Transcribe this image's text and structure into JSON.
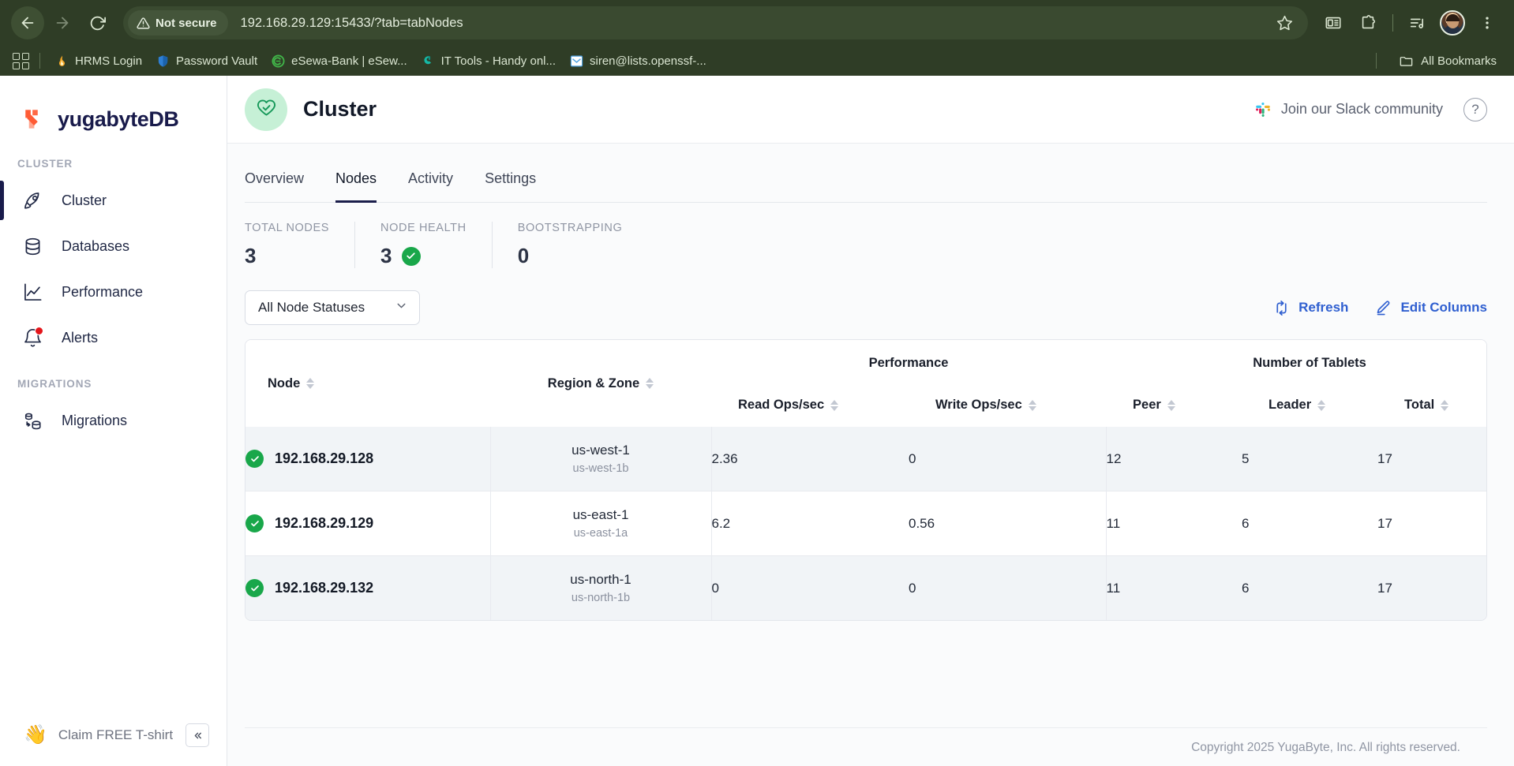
{
  "browser": {
    "security_label": "Not secure",
    "url": "192.168.29.129:15433/?tab=tabNodes",
    "back_icon": "back-arrow-icon",
    "forward_icon": "forward-arrow-icon",
    "reload_icon": "reload-icon",
    "star_icon": "bookmark-star-icon",
    "reading_list_icon": "reading-list-icon",
    "extensions_icon": "extensions-puzzle-icon",
    "media_icon": "media-playlist-icon",
    "menu_icon": "kebab-menu-icon",
    "bookmarks": [
      {
        "label": "HRMS Login",
        "favicon": "flame-icon",
        "color": "#f5a623"
      },
      {
        "label": "Password Vault",
        "favicon": "shield-icon",
        "color": "#2e7fd4"
      },
      {
        "label": "eSewa-Bank | eSew...",
        "favicon": "esewa-icon",
        "color": "#41b549"
      },
      {
        "label": "IT Tools - Handy onl...",
        "favicon": "ittools-icon",
        "color": "#15b8a6"
      },
      {
        "label": "siren@lists.openssf-...",
        "favicon": "mail-icon",
        "color": "#4fa3e3"
      }
    ],
    "all_bookmarks_label": "All Bookmarks",
    "all_bookmarks_icon": "folder-icon",
    "apps_icon": "apps-grid-icon"
  },
  "sidebar": {
    "brand": "yugabyteDB",
    "brand_logo_icon": "yugabyte-logo-icon",
    "sections": [
      {
        "label": "CLUSTER",
        "items": [
          {
            "label": "Cluster",
            "icon": "rocket-icon",
            "selected": true
          },
          {
            "label": "Databases",
            "icon": "database-icon",
            "selected": false
          },
          {
            "label": "Performance",
            "icon": "line-chart-icon",
            "selected": false
          },
          {
            "label": "Alerts",
            "icon": "bell-icon",
            "selected": false,
            "badge": true
          }
        ]
      },
      {
        "label": "MIGRATIONS",
        "items": [
          {
            "label": "Migrations",
            "icon": "migration-icon",
            "selected": false
          }
        ]
      }
    ],
    "tshirt_label": "Claim FREE T-shirt",
    "tshirt_icon": "waving-hand-icon",
    "collapse_icon": "double-chevron-left-icon"
  },
  "header": {
    "title": "Cluster",
    "status_icon": "heart-check-icon",
    "slack_label": "Join our Slack community",
    "slack_icon": "slack-icon",
    "help_label": "?",
    "help_icon": "help-circle-icon"
  },
  "tabs": [
    {
      "label": "Overview",
      "active": false
    },
    {
      "label": "Nodes",
      "active": true
    },
    {
      "label": "Activity",
      "active": false
    },
    {
      "label": "Settings",
      "active": false
    }
  ],
  "stats": [
    {
      "label": "TOTAL NODES",
      "value": "3",
      "check": false
    },
    {
      "label": "NODE HEALTH",
      "value": "3",
      "check": true
    },
    {
      "label": "BOOTSTRAPPING",
      "value": "0",
      "check": false
    }
  ],
  "toolbar": {
    "status_filter_value": "All Node Statuses",
    "status_filter_caret_icon": "chevron-down-icon",
    "refresh_label": "Refresh",
    "refresh_icon": "refresh-icon",
    "edit_columns_label": "Edit Columns",
    "edit_columns_icon": "pencil-icon"
  },
  "table": {
    "group_headers": {
      "performance": "Performance",
      "tablets": "Number of Tablets"
    },
    "columns": {
      "node": "Node",
      "region_zone": "Region & Zone",
      "read_ops": "Read Ops/sec",
      "write_ops": "Write Ops/sec",
      "peer": "Peer",
      "leader": "Leader",
      "total": "Total"
    },
    "sort_icon": "sort-arrows-icon",
    "status_icon": "check-circle-icon",
    "rows": [
      {
        "node": "192.168.29.128",
        "status": "healthy",
        "region": "us-west-1",
        "zone": "us-west-1b",
        "read_ops": "2.36",
        "write_ops": "0",
        "peer": "12",
        "leader": "5",
        "total": "17"
      },
      {
        "node": "192.168.29.129",
        "status": "healthy",
        "region": "us-east-1",
        "zone": "us-east-1a",
        "read_ops": "6.2",
        "write_ops": "0.56",
        "peer": "11",
        "leader": "6",
        "total": "17"
      },
      {
        "node": "192.168.29.132",
        "status": "healthy",
        "region": "us-north-1",
        "zone": "us-north-1b",
        "read_ops": "0",
        "write_ops": "0",
        "peer": "11",
        "leader": "6",
        "total": "17"
      }
    ]
  },
  "footer": {
    "copyright": "Copyright 2025 YugaByte, Inc. All rights reserved."
  },
  "colors": {
    "chrome_bg": "#2f3d26",
    "brand_navy": "#191b4b",
    "brand_orange": "#ff5c35",
    "accent_blue": "#2f5fd0",
    "status_green": "#19a74a",
    "alert_red": "#e4161b"
  }
}
